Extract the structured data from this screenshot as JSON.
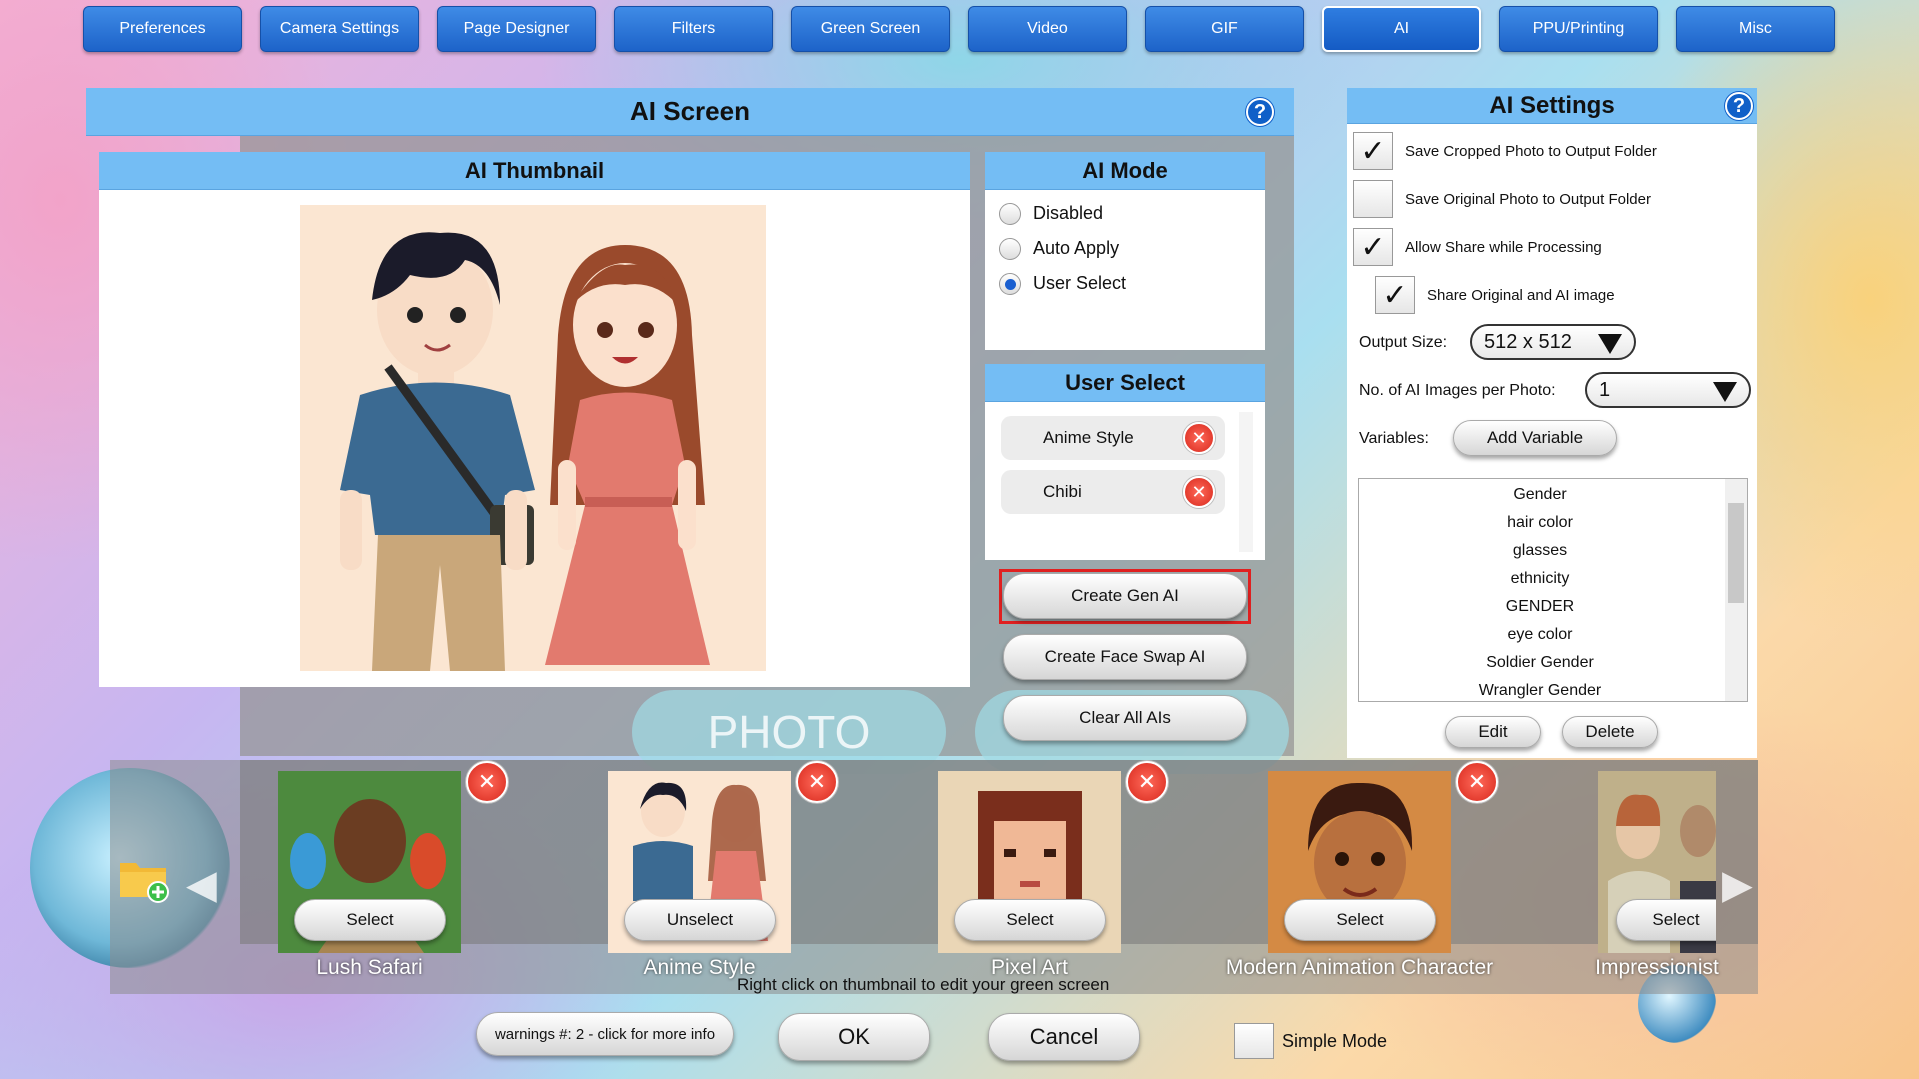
{
  "tabs": [
    "Preferences",
    "Camera Settings",
    "Page Designer",
    "Filters",
    "Green Screen",
    "Video",
    "GIF",
    "AI",
    "PPU/Printing",
    "Misc"
  ],
  "active_tab": "AI",
  "screen": {
    "title": "AI Screen",
    "help": "?"
  },
  "thumbnail": {
    "title": "AI Thumbnail"
  },
  "ai_mode": {
    "title": "AI Mode",
    "options": [
      "Disabled",
      "Auto Apply",
      "User Select"
    ],
    "selected": "User Select"
  },
  "user_select": {
    "title": "User Select",
    "items": [
      "Anime Style",
      "Chibi"
    ]
  },
  "actions": {
    "create_gen_ai": "Create Gen AI",
    "create_face_swap_ai": "Create Face Swap AI",
    "clear_all_ais": "Clear All AIs"
  },
  "photo_label": "PHOTO",
  "settings": {
    "title": "AI Settings",
    "help": "?",
    "checkboxes": [
      {
        "label": "Save Cropped Photo to Output Folder",
        "checked": true
      },
      {
        "label": "Save Original Photo to Output Folder",
        "checked": false
      },
      {
        "label": "Allow Share while Processing",
        "checked": true
      },
      {
        "label": "Share Original and AI image",
        "checked": true
      }
    ],
    "output_size_label": "Output Size:",
    "output_size_value": "512 x 512",
    "images_per_photo_label": "No. of AI Images per Photo:",
    "images_per_photo_value": "1",
    "variables_label": "Variables:",
    "add_variable": "Add Variable",
    "variables": [
      "Gender",
      "hair color",
      "glasses",
      "ethnicity",
      "GENDER",
      "eye color",
      "Soldier Gender",
      "Wrangler Gender"
    ],
    "edit": "Edit",
    "delete": "Delete"
  },
  "carousel": [
    {
      "name": "Lush Safari",
      "button": "Select"
    },
    {
      "name": "Anime Style",
      "button": "Unselect"
    },
    {
      "name": "Pixel Art",
      "button": "Select"
    },
    {
      "name": "Modern Animation Character",
      "button": "Select"
    },
    {
      "name": "Impressionist",
      "button": "Select"
    }
  ],
  "hint": "Right click on thumbnail to edit your green screen",
  "footer": {
    "warnings": "warnings #: 2 - click for more info",
    "ok": "OK",
    "cancel": "Cancel",
    "simple_mode": "Simple Mode"
  },
  "colors": {
    "tab": "#1d63c9",
    "header": "#74bdf4",
    "highlight": "#e02020",
    "help": "#1060c8"
  }
}
